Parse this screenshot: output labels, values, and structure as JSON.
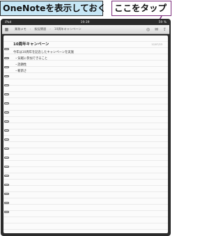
{
  "callouts": {
    "left": "OneNoteを表示しておく",
    "right": "ここをタップ"
  },
  "status": {
    "carrier": "iPad",
    "time": "19:39",
    "battery": "59 %"
  },
  "toolbar": {
    "breadcrumbs": [
      "業務メモ",
      "販促関連",
      "10周年キャンペーン"
    ]
  },
  "note": {
    "title": "10周年キャンペーン",
    "date": "12/07/23",
    "lines": [
      "今年は10周年を記念したキャンペーンを実施",
      "・気軽に参加できること",
      "・話題性",
      "・斬新さ"
    ]
  },
  "colors": {
    "callout_left_bg": "#c7e7f6",
    "callout_right_border": "#7a2c7a",
    "device_frame": "#2b2b2b"
  }
}
